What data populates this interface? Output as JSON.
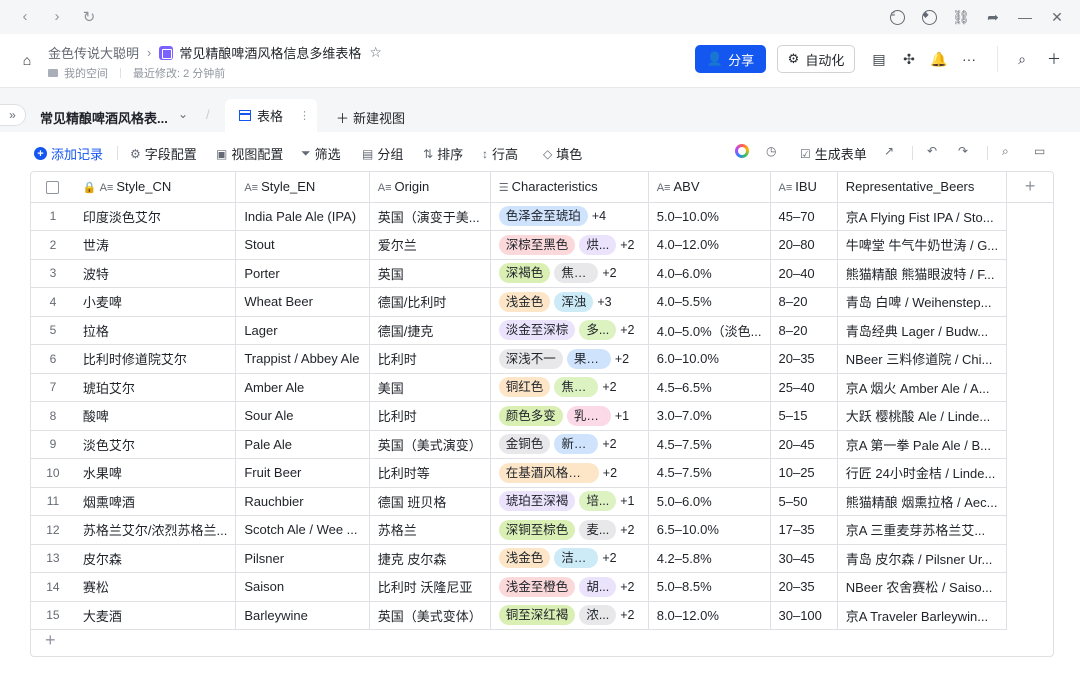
{
  "header": {
    "breadcrumb_root": "金色传说大聪明",
    "doc_title": "常见精酿啤酒风格信息多维表格",
    "location": "我的空间",
    "last_modified": "最近修改: 2 分钟前",
    "share_label": "分享",
    "automation_label": "自动化"
  },
  "tabs": {
    "table_name": "常见精酿啤酒风格表...",
    "view_label": "表格",
    "new_view_label": "新建视图"
  },
  "toolbar": {
    "add_record": "添加记录",
    "field_config": "字段配置",
    "view_config": "视图配置",
    "filter": "筛选",
    "group": "分组",
    "sort": "排序",
    "row_height": "行高",
    "fill": "填色",
    "generate_form": "生成表单"
  },
  "table": {
    "columns": [
      "Style_CN",
      "Style_EN",
      "Origin",
      "Characteristics",
      "ABV",
      "IBU",
      "Representative_Beers"
    ],
    "rows": [
      {
        "n": "1",
        "cn": "印度淡色艾尔",
        "en": "India Pale Ale (IPA)",
        "origin": "英国（演变于美...",
        "tag1": "色泽金至琥珀",
        "tag1_bg": "#cfe3fd",
        "tag2": "",
        "tag2_bg": "#e8e8ea",
        "more": "+4",
        "abv": "5.0–10.0%",
        "ibu": "45–70",
        "beers": "京A Flying Fist IPA / Sto..."
      },
      {
        "n": "2",
        "cn": "世涛",
        "en": "Stout",
        "origin": "爱尔兰",
        "tag1": "深棕至黑色",
        "tag1_bg": "#fbd9db",
        "tag2": "烘...",
        "tag2_bg": "#ebe2fc",
        "more": "+2",
        "abv": "4.0–12.0%",
        "ibu": "20–80",
        "beers": "牛啤堂 牛气牛奶世涛 / G..."
      },
      {
        "n": "3",
        "cn": "波特",
        "en": "Porter",
        "origin": "英国",
        "tag1": "深褐色",
        "tag1_bg": "#d9efb3",
        "tag2": "焦糖与...",
        "tag2_bg": "#e8e8ea",
        "more": "+2",
        "abv": "4.0–6.0%",
        "ibu": "20–40",
        "beers": "熊猫精酿 熊猫眼波特 / F..."
      },
      {
        "n": "4",
        "cn": "小麦啤",
        "en": "Wheat Beer",
        "origin": "德国/比利时",
        "tag1": "浅金色",
        "tag1_bg": "#fde6c8",
        "tag2": "浑浊",
        "tag2_bg": "#cdebf7",
        "more": "+3",
        "abv": "4.0–5.5%",
        "ibu": "8–20",
        "beers": "青岛 白啤 / Weihenstep..."
      },
      {
        "n": "5",
        "cn": "拉格",
        "en": "Lager",
        "origin": "德国/捷克",
        "tag1": "淡金至深棕",
        "tag1_bg": "#ebe2fc",
        "tag2": "多...",
        "tag2_bg": "#dcf2c0",
        "more": "+2",
        "abv": "4.0–5.0%（淡色...",
        "ibu": "8–20",
        "beers": "青岛经典 Lager / Budw..."
      },
      {
        "n": "6",
        "cn": "比利时修道院艾尔",
        "en": "Trappist / Abbey Ale",
        "origin": "比利时",
        "tag1": "深浅不一",
        "tag1_bg": "#e8e8ea",
        "tag2": "果香...",
        "tag2_bg": "#cfe3fd",
        "more": "+2",
        "abv": "6.0–10.0%",
        "ibu": "20–35",
        "beers": "NBeer 三料修道院 / Chi..."
      },
      {
        "n": "7",
        "cn": "琥珀艾尔",
        "en": "Amber Ale",
        "origin": "美国",
        "tag1": "铜红色",
        "tag1_bg": "#fde6c8",
        "tag2": "焦糖麦...",
        "tag2_bg": "#dcf2c0",
        "more": "+2",
        "abv": "4.5–6.5%",
        "ibu": "25–40",
        "beers": "京A 烟火 Amber Ale / A..."
      },
      {
        "n": "8",
        "cn": "酸啤",
        "en": "Sour Ale",
        "origin": "比利时",
        "tag1": "颜色多变",
        "tag1_bg": "#d9efb3",
        "tag2": "乳酸...",
        "tag2_bg": "#fbd9e6",
        "more": "+1",
        "abv": "3.0–7.0%",
        "ibu": "5–15",
        "beers": "大跃 樱桃酸 Ale / Linde..."
      },
      {
        "n": "9",
        "cn": "淡色艾尔",
        "en": "Pale Ale",
        "origin": "英国（美式演变）",
        "tag1": "金铜色",
        "tag1_bg": "#e8e8ea",
        "tag2": "新鲜花...",
        "tag2_bg": "#cfe3fd",
        "more": "+2",
        "abv": "4.5–7.5%",
        "ibu": "20–45",
        "beers": "京A 第一拳 Pale Ale / B..."
      },
      {
        "n": "10",
        "cn": "水果啤",
        "en": "Fruit Beer",
        "origin": "比利时等",
        "tag1": "在基酒风格上加...",
        "tag1_bg": "#fde6c8",
        "tag2": "",
        "tag2_bg": "#e8e8ea",
        "more": "+2",
        "abv": "4.5–7.5%",
        "ibu": "10–25",
        "beers": "行匠 24小时金桔 / Linde..."
      },
      {
        "n": "11",
        "cn": "烟熏啤酒",
        "en": "Rauchbier",
        "origin": "德国 班贝格",
        "tag1": "琥珀至深褐",
        "tag1_bg": "#ebe2fc",
        "tag2": "培...",
        "tag2_bg": "#dcf2c0",
        "more": "+1",
        "abv": "5.0–6.0%",
        "ibu": "5–50",
        "beers": "熊猫精酿 烟熏拉格 / Aec..."
      },
      {
        "n": "12",
        "cn": "苏格兰艾尔/浓烈苏格兰...",
        "en": "Scotch Ale / Wee ...",
        "origin": "苏格兰",
        "tag1": "深铜至棕色",
        "tag1_bg": "#d9efb3",
        "tag2": "麦...",
        "tag2_bg": "#e8e8ea",
        "more": "+2",
        "abv": "6.5–10.0%",
        "ibu": "17–35",
        "beers": "京A 三重麦芽苏格兰艾..."
      },
      {
        "n": "13",
        "cn": "皮尔森",
        "en": "Pilsner",
        "origin": "捷克 皮尔森",
        "tag1": "浅金色",
        "tag1_bg": "#fde6c8",
        "tag2": "洁净麦...",
        "tag2_bg": "#cdebf7",
        "more": "+2",
        "abv": "4.2–5.8%",
        "ibu": "30–45",
        "beers": "青岛 皮尔森 / Pilsner Ur..."
      },
      {
        "n": "14",
        "cn": "赛松",
        "en": "Saison",
        "origin": "比利时 沃隆尼亚",
        "tag1": "浅金至橙色",
        "tag1_bg": "#fbd9db",
        "tag2": "胡...",
        "tag2_bg": "#ebe2fc",
        "more": "+2",
        "abv": "5.0–8.5%",
        "ibu": "20–35",
        "beers": "NBeer 农舍赛松 / Saiso..."
      },
      {
        "n": "15",
        "cn": "大麦酒",
        "en": "Barleywine",
        "origin": "英国（美式变体）",
        "tag1": "铜至深红褐",
        "tag1_bg": "#d9efb3",
        "tag2": "浓...",
        "tag2_bg": "#e8e8ea",
        "more": "+2",
        "abv": "8.0–12.0%",
        "ibu": "30–100",
        "beers": "京A Traveler Barleywin..."
      }
    ]
  }
}
